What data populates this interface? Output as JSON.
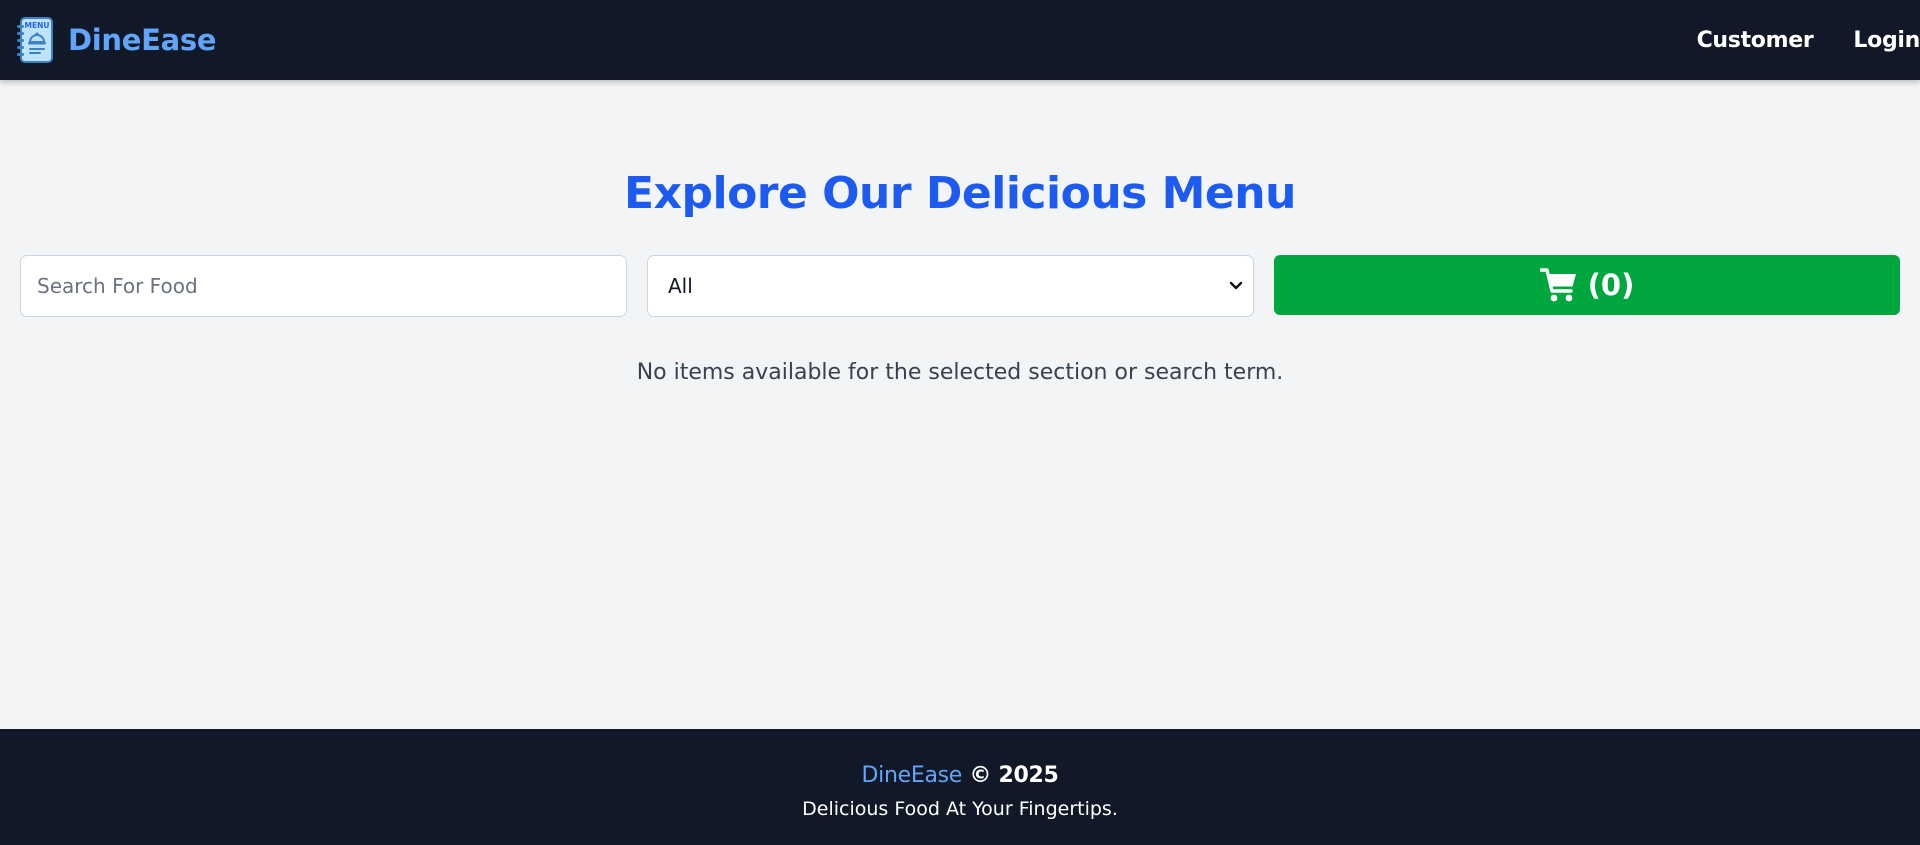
{
  "navbar": {
    "brand_name": "DineEase",
    "logo_text": "MENU",
    "links": {
      "customer": "Customer",
      "login": "Login"
    }
  },
  "main": {
    "title": "Explore Our Delicious Menu",
    "search": {
      "placeholder": "Search For Food",
      "value": ""
    },
    "section_select": {
      "selected": "All"
    },
    "cart": {
      "count_label": "(0)",
      "icon": "shopping-cart-icon"
    },
    "empty_message": "No items available for the selected section or search term."
  },
  "footer": {
    "brand": "DineEase",
    "copyright": "© 2025",
    "tagline": "Delicious Food At Your Fingertips."
  },
  "colors": {
    "navbar_bg": "#111827",
    "brand_blue": "#60a5fa",
    "title_blue": "#1d5bf0",
    "cart_green": "#00a63e",
    "page_bg": "#f3f4f6"
  }
}
